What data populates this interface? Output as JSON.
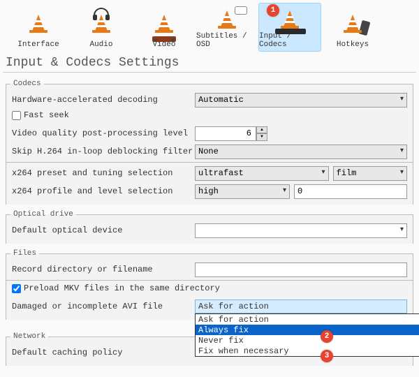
{
  "tabs": {
    "interface": "Interface",
    "audio": "Audio",
    "video": "Video",
    "subtitles": "Subtitles / OSD",
    "input_codecs": "Input / Codecs",
    "hotkeys": "Hotkeys"
  },
  "title": "Input & Codecs Settings",
  "codecs": {
    "legend": "Codecs",
    "hw_decoding_label": "Hardware-accelerated decoding",
    "hw_decoding_value": "Automatic",
    "fast_seek_label": "Fast seek",
    "fast_seek_checked": false,
    "post_proc_label": "Video quality post-processing level",
    "post_proc_value": "6",
    "skip_h264_label": "Skip H.264 in-loop deblocking filter",
    "skip_h264_value": "None",
    "x264_preset_label": "x264 preset and tuning selection",
    "x264_preset_value": "ultrafast",
    "x264_tune_value": "film",
    "x264_profile_label": "x264 profile and level selection",
    "x264_profile_value": "high",
    "x264_level_value": "0"
  },
  "optical": {
    "legend": "Optical drive",
    "default_label": "Default optical device",
    "default_value": ""
  },
  "files": {
    "legend": "Files",
    "record_label": "Record directory or filename",
    "record_value": "",
    "preload_mkv_label": "Preload MKV files in the same directory",
    "preload_mkv_checked": true,
    "avi_label": "Damaged or incomplete AVI file",
    "avi_selected": "Ask for action",
    "avi_options": [
      "Ask for action",
      "Always fix",
      "Never fix",
      "Fix when necessary"
    ]
  },
  "network": {
    "legend": "Network",
    "caching_label": "Default caching policy"
  },
  "badges": {
    "b1": "1",
    "b2": "2",
    "b3": "3"
  }
}
